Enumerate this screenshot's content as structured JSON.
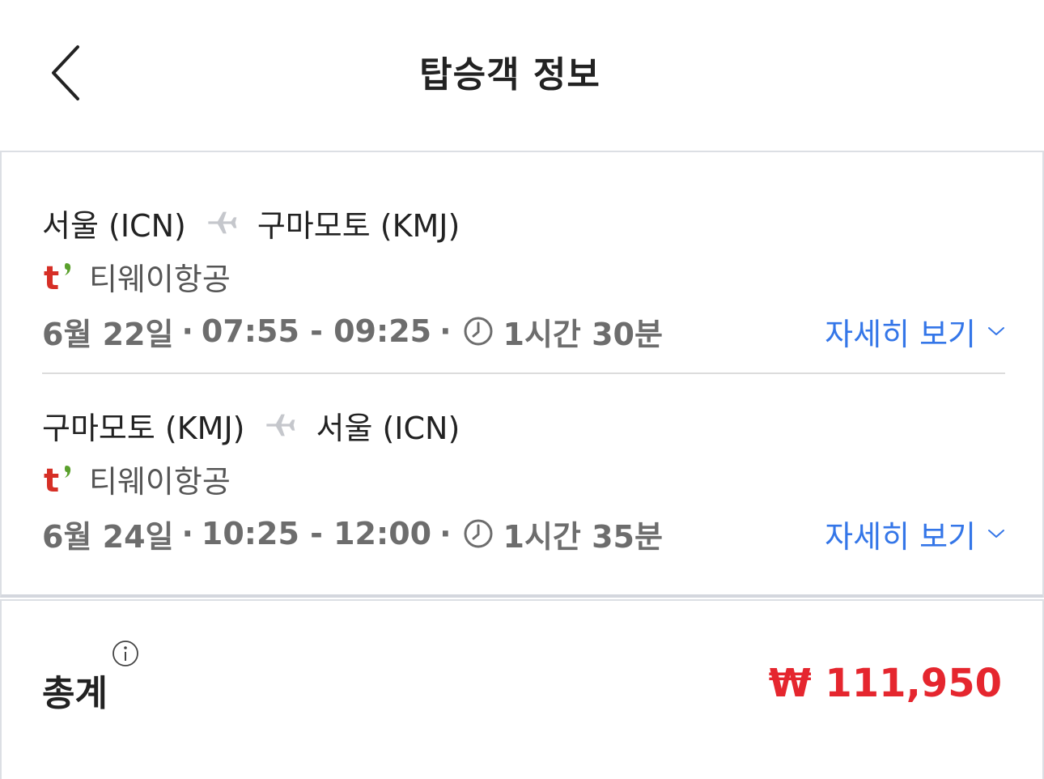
{
  "header": {
    "title": "탑승객 정보",
    "back_icon": "chevron-left-icon"
  },
  "segments": [
    {
      "origin": "서울 (ICN)",
      "destination": "구마모토 (KMJ)",
      "airline": "티웨이항공",
      "date": "6월 22일",
      "time": "07:55 - 09:25",
      "duration": "1시간 30분",
      "detail_link": "자세히 보기"
    },
    {
      "origin": "구마모토 (KMJ)",
      "destination": "서울 (ICN)",
      "airline": "티웨이항공",
      "date": "6월 24일",
      "time": "10:25 - 12:00",
      "duration": "1시간 35분",
      "detail_link": "자세히 보기"
    }
  ],
  "separator": "·",
  "total": {
    "label": "총계",
    "price": "₩ 111,950"
  },
  "colors": {
    "link_blue": "#3476e8",
    "price_red": "#e5262e",
    "airline_logo_red": "#d62f26",
    "airline_logo_green": "#5aa02c"
  }
}
